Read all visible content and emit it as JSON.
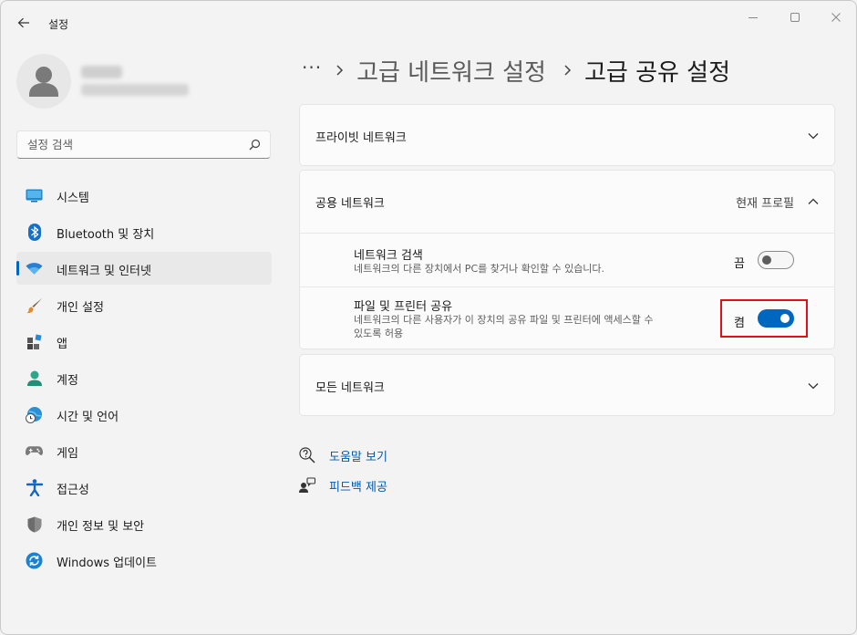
{
  "window": {
    "title": "설정"
  },
  "profile": {
    "name": "",
    "email": ""
  },
  "search": {
    "placeholder": "설정 검색"
  },
  "sidebar": {
    "items": [
      {
        "label": "시스템",
        "icon": "monitor-icon"
      },
      {
        "label": "Bluetooth 및 장치",
        "icon": "bluetooth-icon"
      },
      {
        "label": "네트워크 및 인터넷",
        "icon": "wifi-icon",
        "active": true
      },
      {
        "label": "개인 설정",
        "icon": "brush-icon"
      },
      {
        "label": "앱",
        "icon": "apps-icon"
      },
      {
        "label": "계정",
        "icon": "person-icon"
      },
      {
        "label": "시간 및 언어",
        "icon": "globe-clock-icon"
      },
      {
        "label": "게임",
        "icon": "gamepad-icon"
      },
      {
        "label": "접근성",
        "icon": "accessibility-icon"
      },
      {
        "label": "개인 정보 및 보안",
        "icon": "shield-icon"
      },
      {
        "label": "Windows 업데이트",
        "icon": "update-icon"
      }
    ]
  },
  "breadcrumb": {
    "more": "···",
    "parent": "고급 네트워크 설정",
    "current": "고급 공유 설정"
  },
  "sections": {
    "private": {
      "title": "프라이빗 네트워크"
    },
    "public": {
      "title": "공용 네트워크",
      "badge": "현재 프로필",
      "settings": {
        "discovery": {
          "title": "네트워크 검색",
          "desc": "네트워크의 다른 장치에서 PC를 찾거나 확인할 수 있습니다.",
          "state": "끔"
        },
        "sharing": {
          "title": "파일 및 프린터 공유",
          "desc_line1": "네트워크의 다른 사용자가 이 장치의 공유 파일 및 프린터에 액세스할 수",
          "desc_line2": "있도록 허용",
          "state": "켬"
        }
      }
    },
    "all": {
      "title": "모든 네트워크"
    }
  },
  "links": {
    "help": "도움말 보기",
    "feedback": "피드백 제공"
  },
  "colors": {
    "accent": "#0067c0",
    "highlight": "#e0101a",
    "link": "#0558a6"
  }
}
